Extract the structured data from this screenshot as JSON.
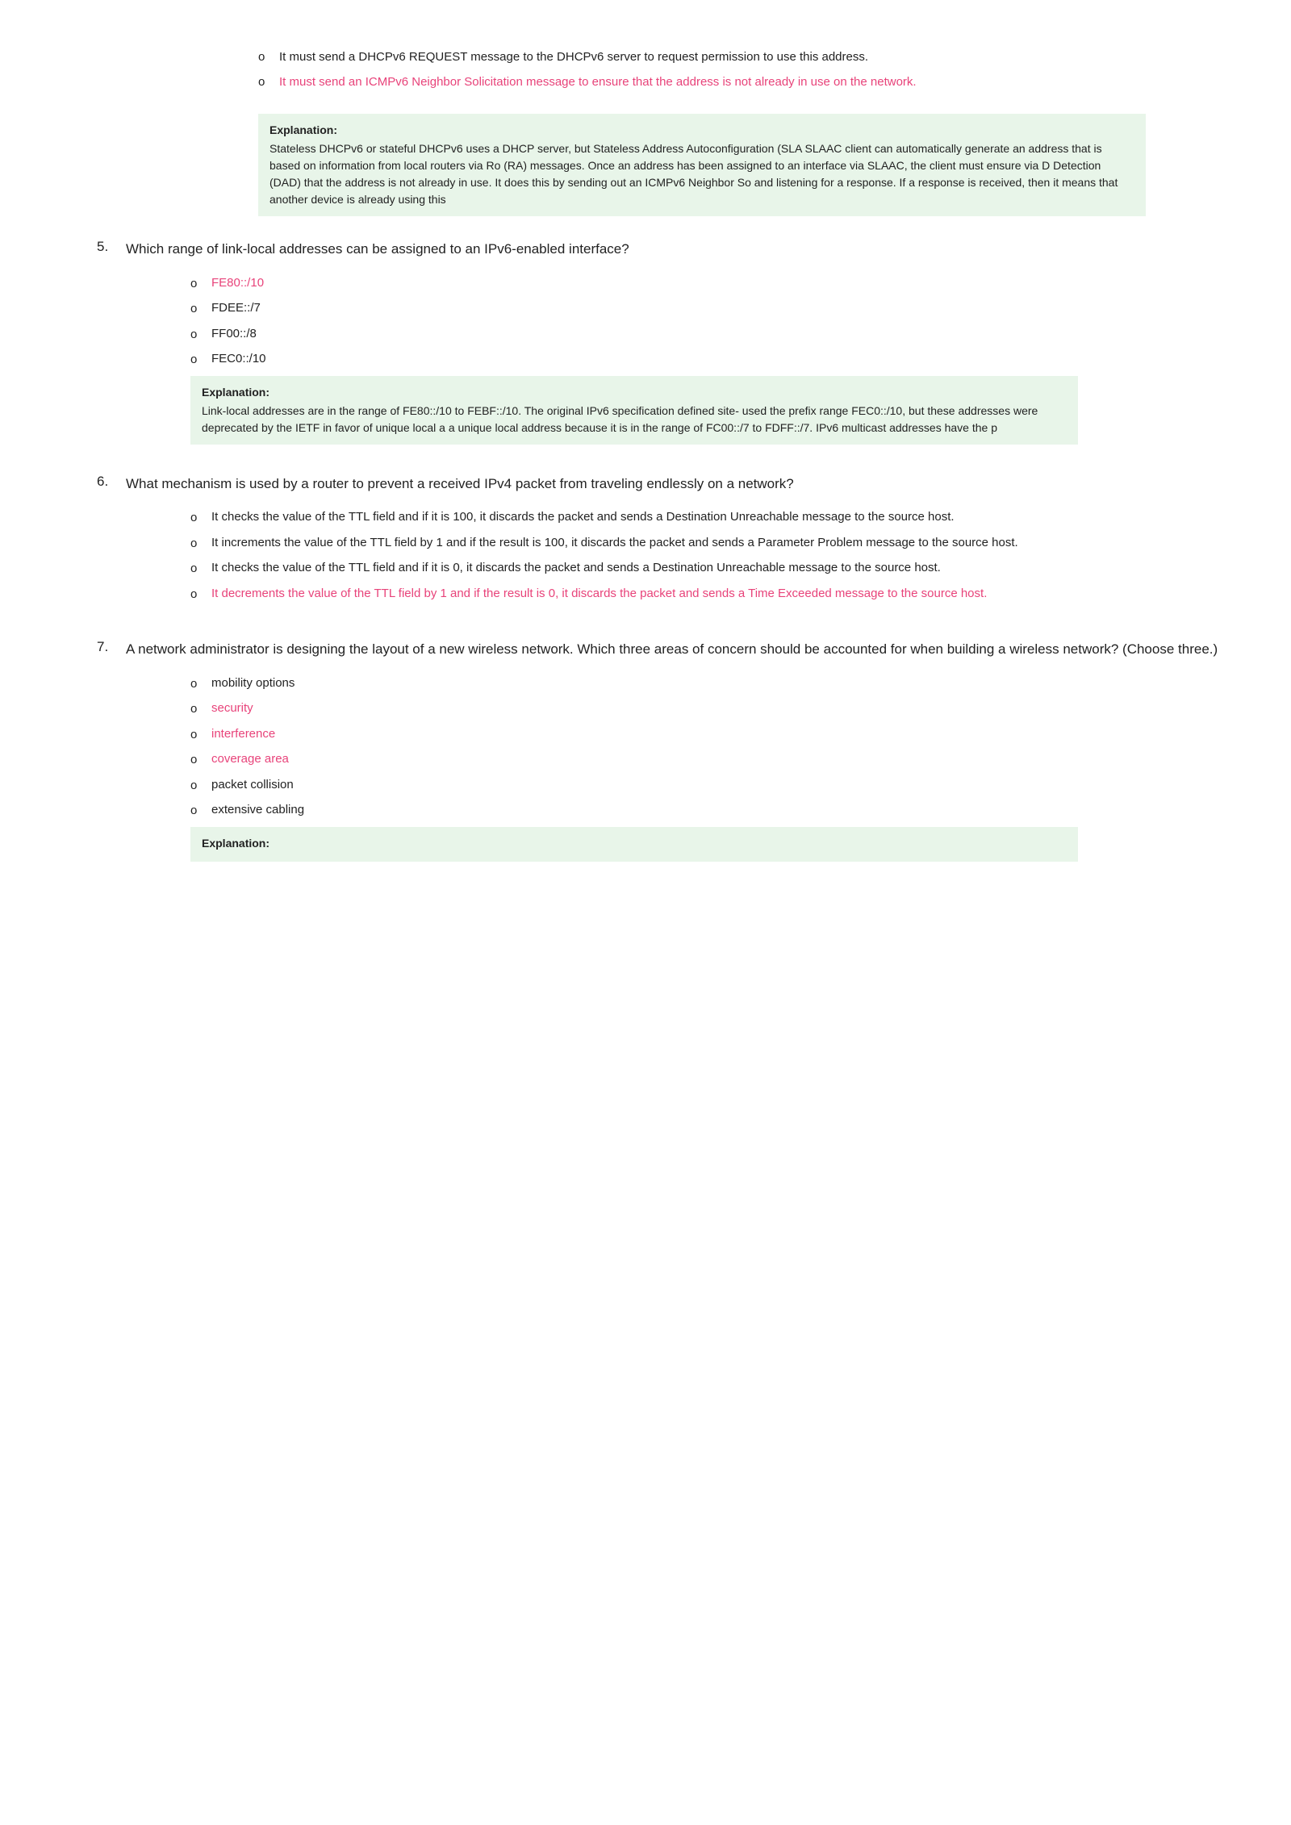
{
  "top_bullets": [
    {
      "id": "tb1",
      "text": "It must send a DHCPv6 REQUEST message to the DHCPv6 server to request permission to use this address.",
      "correct": false
    },
    {
      "id": "tb2",
      "text": "It must send an ICMPv6 Neighbor Solicitation message to ensure that the address is not already in use on the network.",
      "correct": true
    }
  ],
  "top_explanation": {
    "label": "Explanation:",
    "text": "Stateless DHCPv6 or stateful DHCPv6 uses a DHCP server, but Stateless Address Autoconfiguration (SLA SLAAC client can automatically generate an address that is based on information from local routers via Ro (RA) messages. Once an address has been assigned to an interface via SLAAC, the client must ensure via D Detection (DAD) that the address is not already in use. It does this by sending out an ICMPv6 Neighbor So and listening for a response. If a response is received, then it means that another device is already using this"
  },
  "questions": [
    {
      "number": "5.",
      "text": "Which range of link-local addresses can be assigned to an IPv6-enabled interface?",
      "options": [
        {
          "text": "FE80::/10",
          "correct": true
        },
        {
          "text": "FDEE::/7",
          "correct": false
        },
        {
          "text": "FF00::/8",
          "correct": false
        },
        {
          "text": "FEC0::/10",
          "correct": false
        }
      ],
      "explanation": {
        "label": "Explanation:",
        "text": "Link-local addresses are in the range of FE80::/10 to FEBF::/10. The original IPv6 specification defined site- used the prefix range FEC0::/10, but these addresses were deprecated by the IETF in favor of unique local a a unique local address because it is in the range of FC00::/7 to FDFF::/7. IPv6 multicast addresses have the p"
      }
    },
    {
      "number": "6.",
      "text": "What mechanism is used by a router to prevent a received IPv4 packet from traveling endlessly on a network?",
      "options": [
        {
          "text": "It checks the value of the TTL field and if it is 100, it discards the packet and sends a Destination Unreachable message to the source host.",
          "correct": false
        },
        {
          "text": "It increments the value of the TTL field by 1 and if the result is 100, it discards the packet and sends a Parameter Problem message to the source host.",
          "correct": false
        },
        {
          "text": "It checks the value of the TTL field and if it is 0, it discards the packet and sends a Destination Unreachable message to the source host.",
          "correct": false
        },
        {
          "text": "It decrements the value of the TTL field by 1 and if the result is 0, it discards the packet and sends a Time Exceeded message to the source host.",
          "correct": true
        }
      ],
      "explanation": null
    },
    {
      "number": "7.",
      "text": "A network administrator is designing the layout of a new wireless network. Which three areas of concern should be accounted for when building a wireless network? (Choose three.)",
      "options": [
        {
          "text": "mobility options",
          "correct": false
        },
        {
          "text": "security",
          "correct": true
        },
        {
          "text": "interference",
          "correct": true
        },
        {
          "text": "coverage area",
          "correct": true
        },
        {
          "text": "packet collision",
          "correct": false
        },
        {
          "text": "extensive cabling",
          "correct": false
        }
      ],
      "explanation": {
        "label": "Explanation:",
        "text": ""
      }
    }
  ],
  "bullet_char": "o"
}
